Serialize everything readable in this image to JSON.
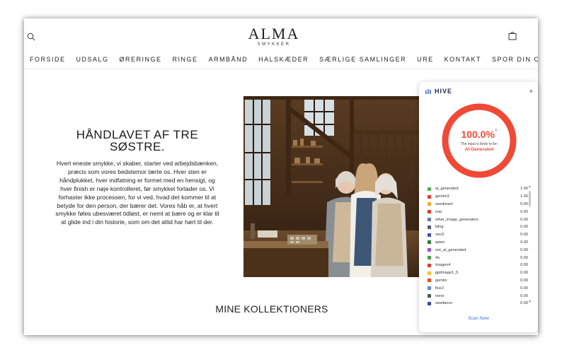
{
  "header": {
    "logo_main": "ALMA",
    "logo_sub": "SMYKKER"
  },
  "nav": {
    "items": [
      "FORSIDE",
      "UDSALG",
      "ØRERINGE",
      "RINGE",
      "ARMBÅND",
      "HALSKÆDER",
      "SÆRLIGE SAMLINGER",
      "URE",
      "KONTAKT",
      "SPOR DIN ORDRE"
    ]
  },
  "hero": {
    "title": "HÅNDLAVET AF TRE SØSTRE.",
    "body": "Hvert eneste smykke, vi skaber, starter ved arbejdsbænken, præcis som vores bedstemor lærte os. Hver sten er håndplukket, hver indfatning er formet med en hensigt, og hver finish er nøje kontrolleret, før smykket forlader os. Vi forhaster ikke processen, for vi ved, hvad det kommer til at betyde for den person, der bærer det. Vores håb er, at hvert smykke føles ubesværet tidløst, er nemt at bære og er klar til at glide ind i din historie, som om det altid har hørt til der."
  },
  "collections": {
    "heading": "MINE KOLLEKTIONERS"
  },
  "hive": {
    "brand": "HIVE",
    "close_label": "×",
    "score_text": "100.0%",
    "score_fraction": 1.0,
    "score_sup": "®",
    "caption": "The input is likely to be:",
    "verdict": "AI-Generated",
    "accent": "#ef4a36",
    "scan_label": "Scan New",
    "classes": [
      {
        "name": "ai_generated",
        "score": "1.00",
        "color": "#4caf50"
      },
      {
        "name": "gemini3",
        "score": "1.00",
        "color": "#e53935"
      },
      {
        "name": "seedream",
        "score": "0.00",
        "color": "#f9a825"
      },
      {
        "name": "mai",
        "score": "0.00",
        "color": "#d84315"
      },
      {
        "name": "other_image_generators",
        "score": "0.00",
        "color": "#5c7fa3"
      },
      {
        "name": "kling",
        "score": "0.00",
        "color": "#4a5d7e"
      },
      {
        "name": "veo3",
        "score": "0.00",
        "color": "#3f51b5"
      },
      {
        "name": "qwen",
        "score": "0.00",
        "color": "#2e7d32"
      },
      {
        "name": "not_ai_generated",
        "score": "0.00",
        "color": "#9c4dcc"
      },
      {
        "name": "4o",
        "score": "0.00",
        "color": "#43a047"
      },
      {
        "name": "imagen4",
        "score": "0.00",
        "color": "#e53935"
      },
      {
        "name": "gptimage1_5",
        "score": "0.00",
        "color": "#fbc02d"
      },
      {
        "name": "gemini",
        "score": "0.00",
        "color": "#e64a19"
      },
      {
        "name": "flux2",
        "score": "0.00",
        "color": "#5c8fc7"
      },
      {
        "name": "none",
        "score": "0.00",
        "color": "#455a64"
      },
      {
        "name": "seedance",
        "score": "0.00",
        "color": "#3949ab"
      }
    ]
  },
  "icons": {
    "search": "search-icon",
    "bag": "shopping-bag-icon",
    "hive_logo": "hive-logo-icon",
    "scroll_up": "scroll-up-icon",
    "scroll_down": "scroll-down-icon"
  }
}
